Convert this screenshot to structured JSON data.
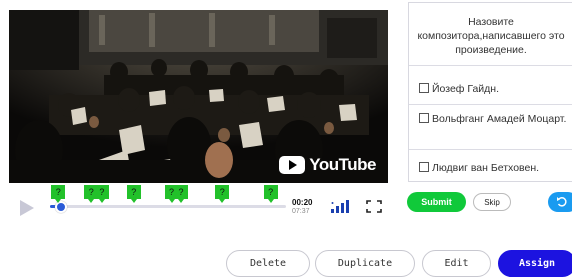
{
  "video": {
    "provider_logo_text": "YouTube",
    "time_current": "00:20",
    "time_total": "07:37",
    "progress_fraction": 0.045,
    "question_markers": [
      {
        "label": "?",
        "position_fraction": 0.035
      },
      {
        "label": "?",
        "position_fraction": 0.175
      },
      {
        "label": "?",
        "position_fraction": 0.22
      },
      {
        "label": "?",
        "position_fraction": 0.355
      },
      {
        "label": "?",
        "position_fraction": 0.515
      },
      {
        "label": "?",
        "position_fraction": 0.555
      },
      {
        "label": "?",
        "position_fraction": 0.73
      },
      {
        "label": "?",
        "position_fraction": 0.935
      }
    ]
  },
  "quiz": {
    "question": "Назовите композитора,написавшего это произведение.",
    "options": [
      {
        "label": "Йозеф Гайдн."
      },
      {
        "label": "Вольфганг Амадей Моцарт."
      },
      {
        "label": "Людвиг ван Бетховен."
      }
    ],
    "submit_label": "Submit",
    "skip_label": "Skip"
  },
  "actions": {
    "delete_label": "Delete",
    "duplicate_label": "Duplicate",
    "edit_label": "Edit",
    "assign_label": "Assign"
  },
  "icons": {
    "play": "play-icon",
    "volume": "volume-icon",
    "fullscreen": "fullscreen-icon",
    "replay": "replay-icon"
  },
  "colors": {
    "marker_green": "#22c12a",
    "submit_green": "#10c93a",
    "assign_blue": "#1c13e0",
    "progress_blue": "#2a5bd7",
    "replay_blue": "#1a9bf0"
  }
}
